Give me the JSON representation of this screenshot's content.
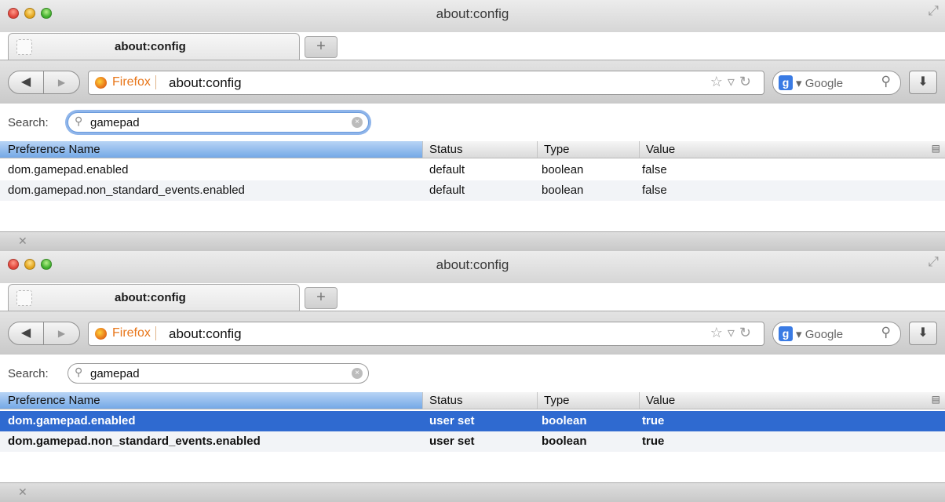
{
  "windows": [
    {
      "title": "about:config",
      "tab_label": "about:config",
      "identity_label": "Firefox",
      "url": "about:config",
      "search_engine": "Google",
      "search_label": "Search:",
      "filter_value": "gamepad",
      "filter_focused": true,
      "columns": {
        "name": "Preference Name",
        "status": "Status",
        "type": "Type",
        "value": "Value"
      },
      "rows": [
        {
          "name": "dom.gamepad.enabled",
          "status": "default",
          "type": "boolean",
          "value": "false",
          "selected": false,
          "bold": false
        },
        {
          "name": "dom.gamepad.non_standard_events.enabled",
          "status": "default",
          "type": "boolean",
          "value": "false",
          "selected": false,
          "bold": false
        }
      ]
    },
    {
      "title": "about:config",
      "tab_label": "about:config",
      "identity_label": "Firefox",
      "url": "about:config",
      "search_engine": "Google",
      "search_label": "Search:",
      "filter_value": "gamepad",
      "filter_focused": false,
      "columns": {
        "name": "Preference Name",
        "status": "Status",
        "type": "Type",
        "value": "Value"
      },
      "rows": [
        {
          "name": "dom.gamepad.enabled",
          "status": "user set",
          "type": "boolean",
          "value": "true",
          "selected": true,
          "bold": true
        },
        {
          "name": "dom.gamepad.non_standard_events.enabled",
          "status": "user set",
          "type": "boolean",
          "value": "true",
          "selected": false,
          "bold": true
        }
      ]
    }
  ],
  "icons": {
    "close": "close-icon",
    "minimize": "minimize-icon",
    "zoom": "zoom-icon",
    "fullscreen": "fullscreen-icon",
    "back": "back-arrow-icon",
    "forward": "forward-arrow-icon",
    "firefox": "firefox-icon",
    "bookmark": "bookmark-star-icon",
    "reload": "reload-icon",
    "google": "google-icon",
    "search": "search-icon",
    "download": "download-icon",
    "clear": "clear-icon",
    "column_picker": "column-picker-icon",
    "findbar_close": "close-icon"
  },
  "colors": {
    "selected_row": "#2f6ad0",
    "sort_header": "#74a8e6",
    "firefox_orange": "#e8761a",
    "google_blue": "#3a7be4"
  }
}
